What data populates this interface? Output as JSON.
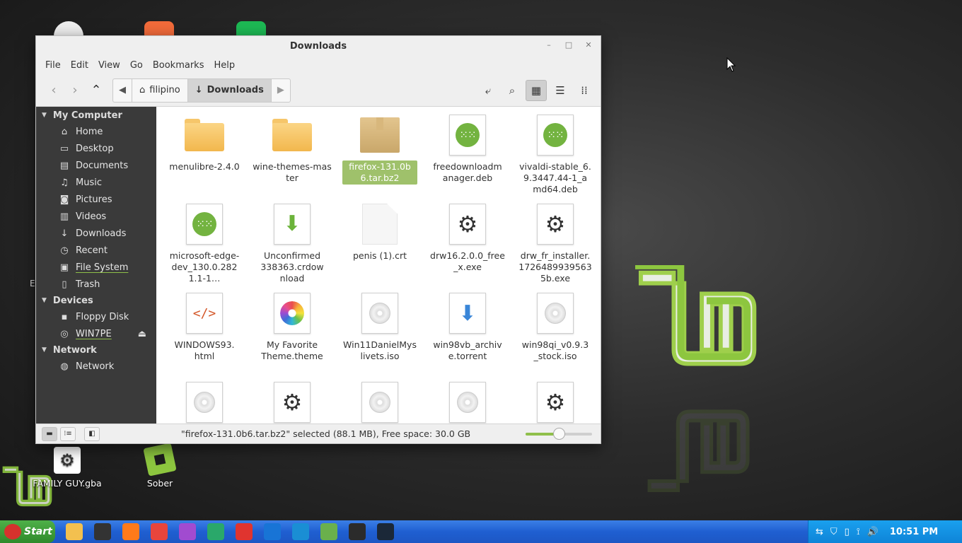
{
  "desktop": {
    "icons": [
      {
        "label": "FAMILY GUY.gba",
        "icon": "gear-icon"
      },
      {
        "label": "Sober",
        "icon": "sober-icon"
      }
    ],
    "stray_letter": "E"
  },
  "window": {
    "title": "Downloads",
    "controls": {
      "minimize": "–",
      "maximize": "□",
      "close": "✕"
    }
  },
  "menu": [
    "File",
    "Edit",
    "View",
    "Go",
    "Bookmarks",
    "Help"
  ],
  "breadcrumb": {
    "home": "filipino",
    "current": "Downloads"
  },
  "sidebar": {
    "sections": [
      {
        "title": "My Computer",
        "items": [
          {
            "label": "Home",
            "icon": "home-icon"
          },
          {
            "label": "Desktop",
            "icon": "desktop-icon"
          },
          {
            "label": "Documents",
            "icon": "documents-icon"
          },
          {
            "label": "Music",
            "icon": "music-icon"
          },
          {
            "label": "Pictures",
            "icon": "pictures-icon"
          },
          {
            "label": "Videos",
            "icon": "videos-icon"
          },
          {
            "label": "Downloads",
            "icon": "downloads-icon"
          },
          {
            "label": "Recent",
            "icon": "recent-icon"
          },
          {
            "label": "File System",
            "icon": "filesystem-icon"
          },
          {
            "label": "Trash",
            "icon": "trash-icon"
          }
        ]
      },
      {
        "title": "Devices",
        "items": [
          {
            "label": "Floppy Disk",
            "icon": "floppy-icon"
          },
          {
            "label": "WIN7PE",
            "icon": "disc-icon"
          }
        ]
      },
      {
        "title": "Network",
        "items": [
          {
            "label": "Network",
            "icon": "network-icon"
          }
        ]
      }
    ]
  },
  "files": [
    {
      "name": "menulibre-2.4.0",
      "type": "folder"
    },
    {
      "name": "wine-themes-master",
      "type": "folder"
    },
    {
      "name": "firefox-131.0b6.tar.bz2",
      "type": "archive",
      "selected": true
    },
    {
      "name": "freedownloadmanager.deb",
      "type": "deb"
    },
    {
      "name": "vivaldi-stable_6.9.3447.44-1_amd64.deb",
      "type": "deb"
    },
    {
      "name": "microsoft-edge-dev_130.0.2821.1-1…",
      "type": "deb"
    },
    {
      "name": "Unconfirmed 338363.crdownload",
      "type": "download"
    },
    {
      "name": "penis (1).crt",
      "type": "blank"
    },
    {
      "name": "drw16.2.0.0_free_x.exe",
      "type": "exe"
    },
    {
      "name": "drw_fr_installer.17264899395635b.exe",
      "type": "exe"
    },
    {
      "name": "WINDOWS93.html",
      "type": "html"
    },
    {
      "name": "My Favorite Theme.theme",
      "type": "theme"
    },
    {
      "name": "Win11DanielMyslivets.iso",
      "type": "iso"
    },
    {
      "name": "win98vb_archive.torrent",
      "type": "torrent"
    },
    {
      "name": "win98qi_v0.9.3_stock.iso",
      "type": "iso"
    },
    {
      "name": "",
      "type": "iso"
    },
    {
      "name": "",
      "type": "exe"
    },
    {
      "name": "",
      "type": "iso"
    },
    {
      "name": "",
      "type": "iso"
    },
    {
      "name": "",
      "type": "exe"
    }
  ],
  "status": {
    "text": "\"firefox-131.0b6.tar.bz2\" selected (88.1 MB), Free space: 30.0 GB",
    "zoom_level": 0.5
  },
  "taskbar": {
    "start_label": "Start",
    "apps": [
      {
        "name": "files-app-icon",
        "color": "#f3c04f"
      },
      {
        "name": "clock-app-icon",
        "color": "#333333"
      },
      {
        "name": "firefox-app-icon",
        "color": "#ff7a1a"
      },
      {
        "name": "chrome-app-icon",
        "color": "#e8453c"
      },
      {
        "name": "lion-app-icon",
        "color": "#a14bd0"
      },
      {
        "name": "edge-dev-app-icon",
        "color": "#2aa86a"
      },
      {
        "name": "vivaldi-app-icon",
        "color": "#e0342f"
      },
      {
        "name": "remote-app-icon",
        "color": "#1874d6"
      },
      {
        "name": "monitor-app-icon",
        "color": "#1a8ed4"
      },
      {
        "name": "grid-app-icon",
        "color": "#6ab04c"
      },
      {
        "name": "terminal-app-icon",
        "color": "#2b2b2b"
      },
      {
        "name": "steam-app-icon",
        "color": "#1b2838"
      }
    ],
    "clock": "10:51 PM"
  },
  "colors": {
    "accent": "#8fbf4a",
    "selection": "#9fc16b",
    "sidebar": "#3a3a3a",
    "taskbar": "#1f5fd1"
  }
}
